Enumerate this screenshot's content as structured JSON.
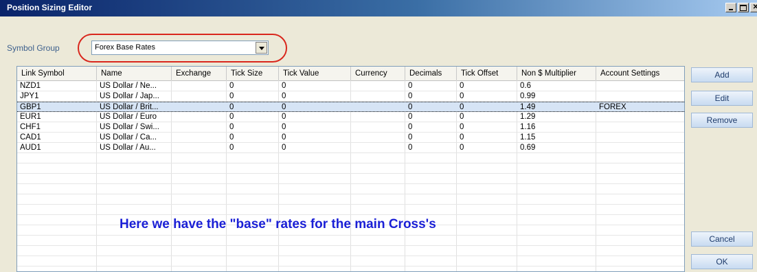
{
  "window": {
    "title": "Position Sizing Editor"
  },
  "symbol_group": {
    "label": "Symbol Group",
    "value": "Forex Base Rates"
  },
  "table": {
    "columns": [
      "Link Symbol",
      "Name",
      "Exchange",
      "Tick Size",
      "Tick Value",
      "Currency",
      "Decimals",
      "Tick Offset",
      "Non $ Multiplier",
      "Account Settings"
    ],
    "rows": [
      [
        "NZD1",
        "US Dollar / Ne...",
        "",
        "0",
        "0",
        "",
        "0",
        "0",
        "0.6",
        ""
      ],
      [
        "JPY1",
        "US Dollar / Jap...",
        "",
        "0",
        "0",
        "",
        "0",
        "0",
        "0.99",
        ""
      ],
      [
        "GBP1",
        "US Dollar / Brit...",
        "",
        "0",
        "0",
        "",
        "0",
        "0",
        "1.49",
        "FOREX"
      ],
      [
        "EUR1",
        "US Dollar / Euro",
        "",
        "0",
        "0",
        "",
        "0",
        "0",
        "1.29",
        ""
      ],
      [
        "CHF1",
        "US Dollar / Swi...",
        "",
        "0",
        "0",
        "",
        "0",
        "0",
        "1.16",
        ""
      ],
      [
        "CAD1",
        "US Dollar / Ca...",
        "",
        "0",
        "0",
        "",
        "0",
        "0",
        "1.15",
        ""
      ],
      [
        "AUD1",
        "US Dollar / Au...",
        "",
        "0",
        "0",
        "",
        "0",
        "0",
        "0.69",
        ""
      ]
    ],
    "selected_row": 2
  },
  "annotation": "Here we have the \"base\" rates for the main Cross's",
  "buttons": {
    "add": "Add",
    "edit": "Edit",
    "remove": "Remove",
    "cancel": "Cancel",
    "ok": "OK"
  },
  "colors": {
    "highlight": "#d9261c",
    "annotation": "#1a1fd6",
    "title_bar": "#0a246a"
  }
}
